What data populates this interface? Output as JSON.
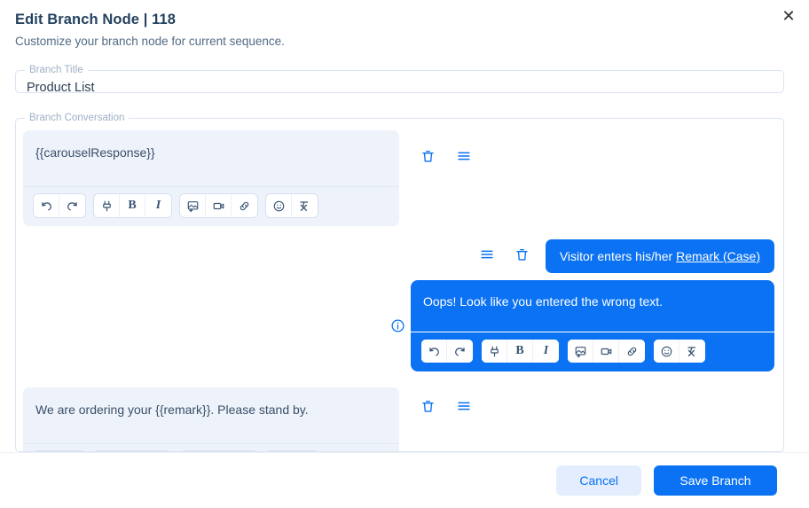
{
  "dialog": {
    "title": "Edit Branch Node | 118",
    "subtitle": "Customize your branch node for current sequence.",
    "close_label": "✕"
  },
  "branch_title": {
    "legend": "Branch Title",
    "value": "Product List"
  },
  "conversation": {
    "legend": "Branch Conversation",
    "messages": [
      {
        "role": "bot",
        "text": "{{carouselResponse}}",
        "tools": [
          "trash-icon",
          "menu-icon"
        ]
      },
      {
        "role": "user",
        "kind": "pill",
        "text_prefix": "Visitor enters his/her ",
        "text_underlined": "Remark (Case)",
        "tools": [
          "menu-icon",
          "trash-icon"
        ]
      },
      {
        "role": "user",
        "kind": "editor",
        "text": "Oops! Look like you entered the wrong text.",
        "info_icon": "info-circle-icon"
      },
      {
        "role": "bot",
        "text": "We are ordering your {{remark}}. Please stand by.",
        "tools": [
          "trash-icon",
          "menu-icon"
        ]
      }
    ]
  },
  "toolbar": {
    "groups": [
      {
        "buttons": [
          {
            "name": "undo-button",
            "icon": "undo-icon"
          },
          {
            "name": "redo-button",
            "icon": "redo-icon"
          }
        ]
      },
      {
        "buttons": [
          {
            "name": "attribute-button",
            "icon": "plug-icon"
          },
          {
            "name": "bold-button",
            "icon": "bold-icon",
            "glyph": "B"
          },
          {
            "name": "italic-button",
            "icon": "italic-icon",
            "glyph": "I"
          }
        ]
      },
      {
        "buttons": [
          {
            "name": "image-button",
            "icon": "image-icon"
          },
          {
            "name": "video-button",
            "icon": "video-icon"
          },
          {
            "name": "link-button",
            "icon": "link-icon"
          }
        ]
      },
      {
        "buttons": [
          {
            "name": "emoji-button",
            "icon": "smiley-icon"
          },
          {
            "name": "clear-format-button",
            "icon": "clear-format-icon"
          }
        ]
      }
    ]
  },
  "footer": {
    "cancel_label": "Cancel",
    "save_label": "Save Branch"
  },
  "colors": {
    "accent": "#0b72f3",
    "accent_soft": "#e3edfd",
    "bot_bubble": "#eef3fb",
    "title_text": "#24425f",
    "subtitle_text": "#526b85",
    "border": "#dbe4f0"
  }
}
